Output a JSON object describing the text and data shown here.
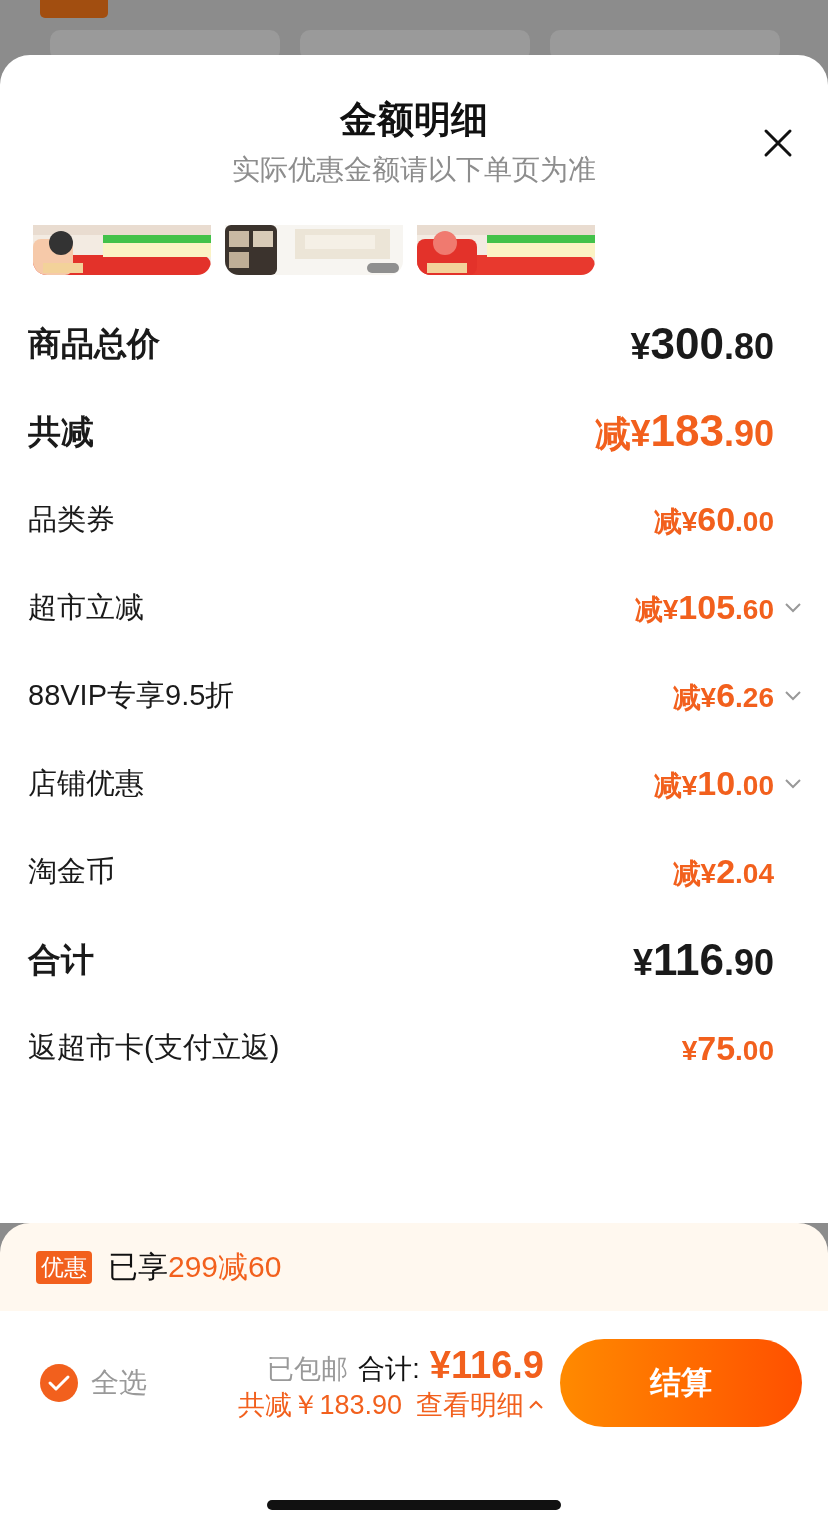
{
  "sheet": {
    "title": "金额明细",
    "subtitle": "实际优惠金额请以下单页为准",
    "rows": [
      {
        "label": "商品总价",
        "amount": "¥300.80",
        "kind": "major",
        "color": "#1a1a1a",
        "expandable": false
      },
      {
        "label": "共减",
        "amount": "减¥183.90",
        "kind": "major",
        "color": "#f2601d",
        "expandable": false
      },
      {
        "label": "品类券",
        "amount": "减¥60.00",
        "kind": "minor",
        "color": "#f2601d",
        "expandable": false
      },
      {
        "label": "超市立减",
        "amount": "减¥105.60",
        "kind": "minor",
        "color": "#f2601d",
        "expandable": true
      },
      {
        "label": "88VIP专享9.5折",
        "amount": "减¥6.26",
        "kind": "minor",
        "color": "#f2601d",
        "expandable": true
      },
      {
        "label": "店铺优惠",
        "amount": "减¥10.00",
        "kind": "minor",
        "color": "#f2601d",
        "expandable": true
      },
      {
        "label": "淘金币",
        "amount": "减¥2.04",
        "kind": "minor",
        "color": "#f2601d",
        "expandable": false
      },
      {
        "label": "合计",
        "amount": "¥116.90",
        "kind": "major",
        "color": "#1a1a1a",
        "expandable": false
      },
      {
        "label": "返超市卡(支付立返)",
        "amount": "¥75.00",
        "kind": "minor",
        "color": "#f2601d",
        "expandable": false
      }
    ]
  },
  "promo": {
    "badge": "优惠",
    "text": "已享",
    "highlight": "299减60"
  },
  "checkout": {
    "select_all": {
      "label": "全选",
      "checked": true
    },
    "shipping": "已包邮",
    "total_label": "合计:",
    "total": "¥116.9",
    "discount": "共减￥183.90",
    "details_link": "查看明细",
    "submit": "结算"
  }
}
